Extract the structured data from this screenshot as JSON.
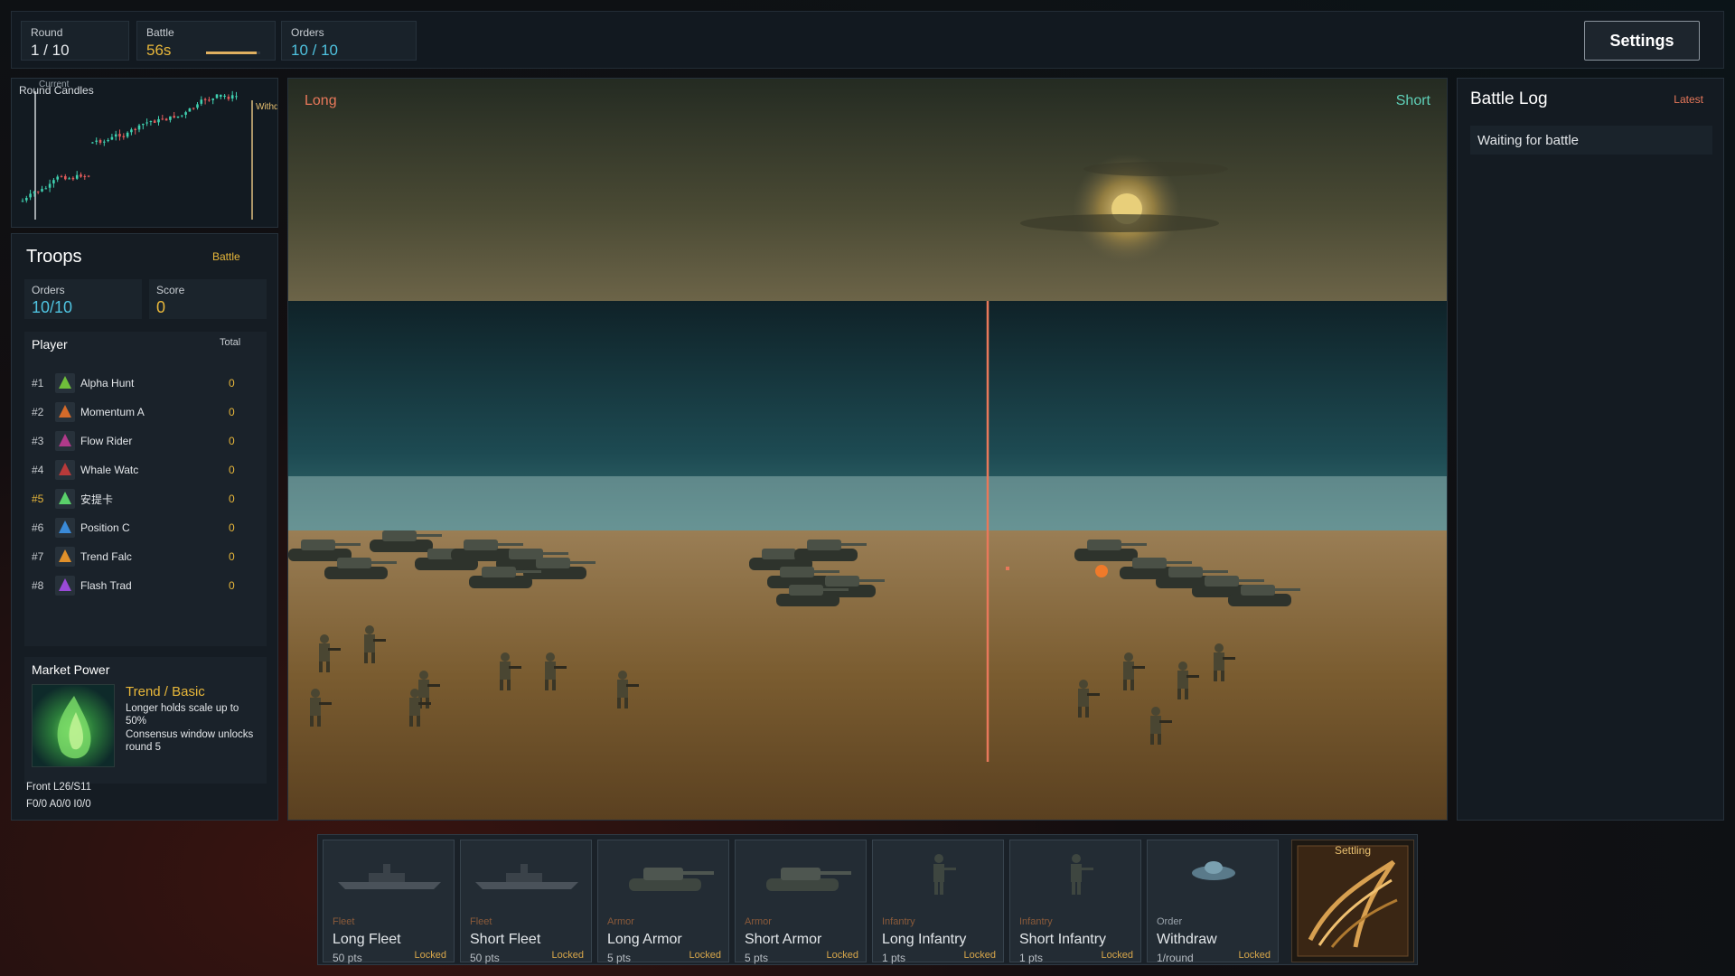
{
  "topbar": {
    "round": {
      "label": "Round",
      "value": "1 / 10"
    },
    "battle": {
      "label": "Battle",
      "value": "56s",
      "timer_fraction": 0.93
    },
    "orders": {
      "label": "Orders",
      "value": "10 / 10"
    },
    "settings_label": "Settings"
  },
  "candles": {
    "title": "Round Candles",
    "current_label": "Current",
    "withdraw_label": "Withdraw"
  },
  "troops": {
    "title": "Troops",
    "battle_tag": "Battle",
    "orders": {
      "label": "Orders",
      "value": "10/10"
    },
    "score": {
      "label": "Score",
      "value": "0"
    },
    "player_header": "Player",
    "total_header": "Total",
    "players": [
      {
        "rank": "#1",
        "name": "Alpha Hunt",
        "total": "0",
        "color": "#6fbf3a"
      },
      {
        "rank": "#2",
        "name": "Momentum A",
        "total": "0",
        "color": "#d46a2a"
      },
      {
        "rank": "#3",
        "name": "Flow Rider",
        "total": "0",
        "color": "#b03a8a"
      },
      {
        "rank": "#4",
        "name": "Whale Watc",
        "total": "0",
        "color": "#b83a3a"
      },
      {
        "rank": "#5",
        "name": "安提卡",
        "total": "0",
        "color": "#5ad06a",
        "highlight": true
      },
      {
        "rank": "#6",
        "name": "Position C",
        "total": "0",
        "color": "#3a8ad8"
      },
      {
        "rank": "#7",
        "name": "Trend Falc",
        "total": "0",
        "color": "#e0902a"
      },
      {
        "rank": "#8",
        "name": "Flash Trad",
        "total": "0",
        "color": "#9a4ad8"
      }
    ],
    "market_power": {
      "title": "Market Power",
      "name": "Trend / Basic",
      "desc1": "Longer holds scale up to 50%",
      "desc2": "Consensus window unlocks round 5"
    },
    "front": "Front L26/S11",
    "forces": "F0/0 A0/0 I0/0"
  },
  "field": {
    "long_label": "Long",
    "short_label": "Short"
  },
  "log": {
    "title": "Battle Log",
    "latest_label": "Latest",
    "entry": "Waiting for battle"
  },
  "cards": [
    {
      "category": "Fleet",
      "name": "Long Fleet",
      "pts": "50 pts",
      "status": "Locked",
      "icon": "battleship-icon"
    },
    {
      "category": "Fleet",
      "name": "Short Fleet",
      "pts": "50 pts",
      "status": "Locked",
      "icon": "battleship-icon"
    },
    {
      "category": "Armor",
      "name": "Long Armor",
      "pts": "5 pts",
      "status": "Locked",
      "icon": "tank-icon"
    },
    {
      "category": "Armor",
      "name": "Short Armor",
      "pts": "5 pts",
      "status": "Locked",
      "icon": "tank-icon"
    },
    {
      "category": "Infantry",
      "name": "Long Infantry",
      "pts": "1 pts",
      "status": "Locked",
      "icon": "soldier-icon"
    },
    {
      "category": "Infantry",
      "name": "Short Infantry",
      "pts": "1 pts",
      "status": "Locked",
      "icon": "soldier-icon"
    },
    {
      "category": "Order",
      "name": "Withdraw",
      "pts": "1/round",
      "status": "Locked",
      "icon": "ufo-icon"
    }
  ],
  "settling_label": "Settling",
  "colors": {
    "accent_gold": "#e8b73a",
    "accent_cyan": "#4fc3e0",
    "long_color": "#e8785a",
    "short_color": "#5fd0b8",
    "up_candle": "#3fd0b0",
    "down_candle": "#e05a5a"
  }
}
